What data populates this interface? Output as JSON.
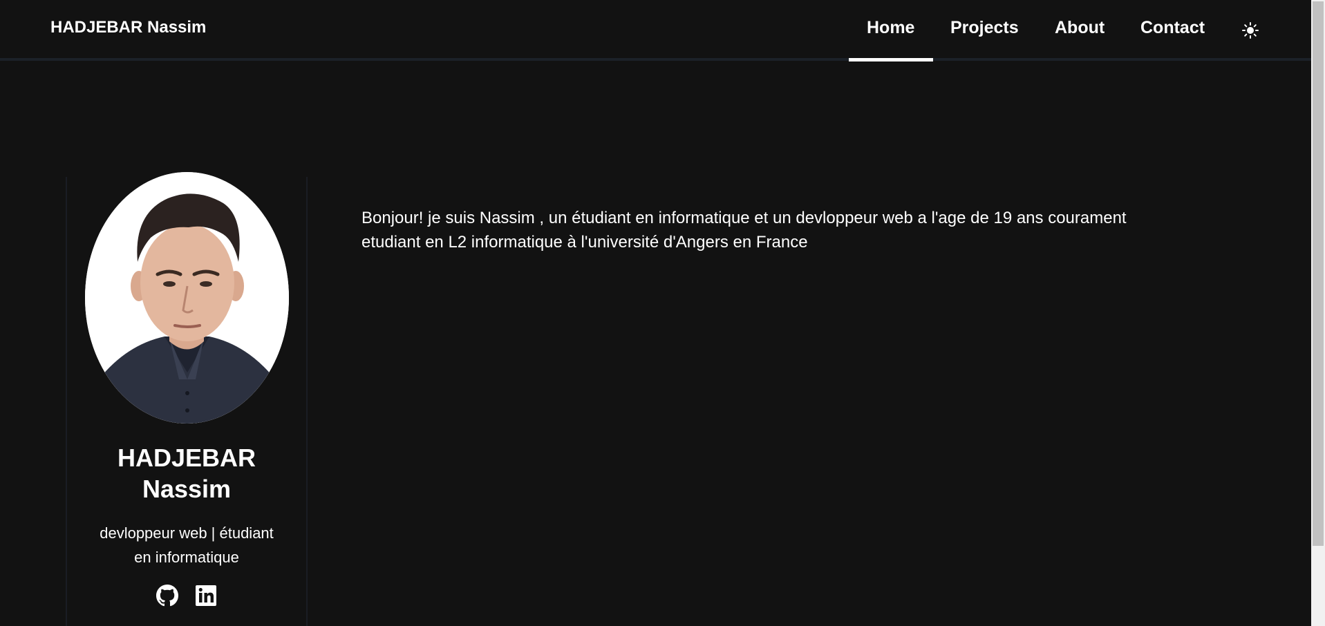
{
  "navbar": {
    "brand": "HADJEBAR Nassim",
    "links": [
      {
        "label": "Home",
        "active": true
      },
      {
        "label": "Projects",
        "active": false
      },
      {
        "label": "About",
        "active": false
      },
      {
        "label": "Contact",
        "active": false
      }
    ],
    "theme_toggle_icon": "sun-icon"
  },
  "profile": {
    "name_line1": "HADJEBAR",
    "name_line2": "Nassim",
    "role_line1": "devloppeur web | étudiant",
    "role_line2": "en informatique",
    "socials": [
      {
        "icon": "github-icon"
      },
      {
        "icon": "linkedin-icon"
      }
    ]
  },
  "bio": {
    "line1": "Bonjour! je suis Nassim , un étudiant en informatique et un devloppeur web a l'age de 19 ans courament",
    "line2": "etudiant en L2 informatique à l'université d'Angers en France"
  },
  "colors": {
    "background": "#121212",
    "text": "#ffffff",
    "navbar_border": "#1c2128",
    "active_underline": "#ffffff"
  }
}
